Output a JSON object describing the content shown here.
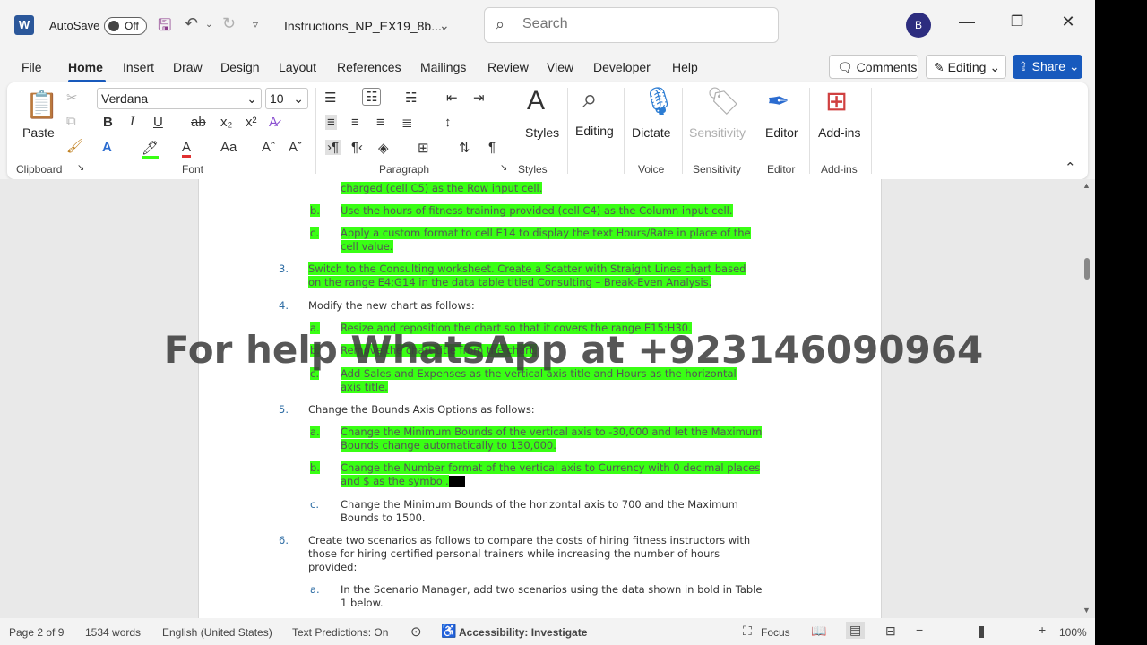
{
  "titlebar": {
    "app_logo": "W",
    "autosave_label": "AutoSave",
    "autosave_state": "Off",
    "doc_title": "Instructions_NP_EX19_8b....",
    "search_placeholder": "Search",
    "user_initial": "B"
  },
  "menu": {
    "items": [
      "File",
      "Home",
      "Insert",
      "Draw",
      "Design",
      "Layout",
      "References",
      "Mailings",
      "Review",
      "View",
      "Developer",
      "Help"
    ],
    "active": "Home",
    "comments_label": "Comments",
    "editing_label": "Editing",
    "share_label": "Share"
  },
  "ribbon": {
    "groups": {
      "clipboard": "Clipboard",
      "font": "Font",
      "paragraph": "Paragraph",
      "styles": "Styles",
      "voice": "Voice",
      "sensitivity": "Sensitivity",
      "editor": "Editor",
      "addins": "Add-ins"
    },
    "paste_label": "Paste",
    "font_name": "Verdana",
    "font_size": "10",
    "styles_label": "Styles",
    "editing_label": "Editing",
    "dictate_label": "Dictate",
    "sensitivity_label": "Sensitivity",
    "editor_label": "Editor",
    "addins_label": "Add-ins"
  },
  "document": {
    "lines": {
      "l1": "charged (cell C5) as the Row input cell.",
      "b_label": "b.",
      "b_text": "Use the hours of fitness training provided (cell C4) as the Column input cell.",
      "c_label": "c.",
      "c_text1": "Apply a custom format to cell E14 to display the text Hours/Rate in place of the",
      "c_text2": "cell value.",
      "n3": "3.",
      "s3_1": "Switch to the Consulting worksheet. Create a Scatter with Straight Lines chart based",
      "s3_2": "on the range E4:G14 in the data table titled Consulting – Break-Even Analysis.",
      "n4": "4.",
      "s4": "Modify the new chart as follows:",
      "a4_label": "a.",
      "a4": "Resize and reposition the chart so that it covers the range E15:H30.",
      "b4_label": "b.",
      "b4": "Remove the chart title from the chart.",
      "c4_label": "c.",
      "c4_1": "Add Sales and Expenses as the vertical axis title and Hours as the horizontal",
      "c4_2": "axis title.",
      "n5": "5.",
      "s5": "Change the Bounds Axis Options as follows:",
      "a5_label": "a.",
      "a5_1": "Change the Minimum Bounds of the vertical axis to -30,000 and let the Maximum",
      "a5_2": "Bounds change automatically to 130,000.",
      "b5_label": "b.",
      "b5_1": "Change the Number format of the vertical axis to Currency with 0 decimal places",
      "b5_2": "and $ as the symbol.",
      "c5_label": "c.",
      "c5_1": "Change the Minimum Bounds of the horizontal axis to 700 and the Maximum",
      "c5_2": "Bounds to 1500.",
      "n6": "6.",
      "s6_1": "Create two scenarios as follows to compare the costs of hiring fitness instructors with",
      "s6_2": "those for hiring certified personal trainers while increasing the number of hours",
      "s6_3": "provided:",
      "a6_label": "a.",
      "a6_1": "In the Scenario Manager, add two scenarios using the data shown in bold in Table",
      "a6_2": "1 below."
    },
    "watermark": "For help WhatsApp at +923146090964"
  },
  "status": {
    "page": "Page 2 of 9",
    "words": "1534 words",
    "language": "English (United States)",
    "predictions": "Text Predictions: On",
    "accessibility": "Accessibility: Investigate",
    "focus": "Focus",
    "zoom": "100%"
  },
  "colors": {
    "accent": "#185abd",
    "highlight": "#39ff14"
  }
}
